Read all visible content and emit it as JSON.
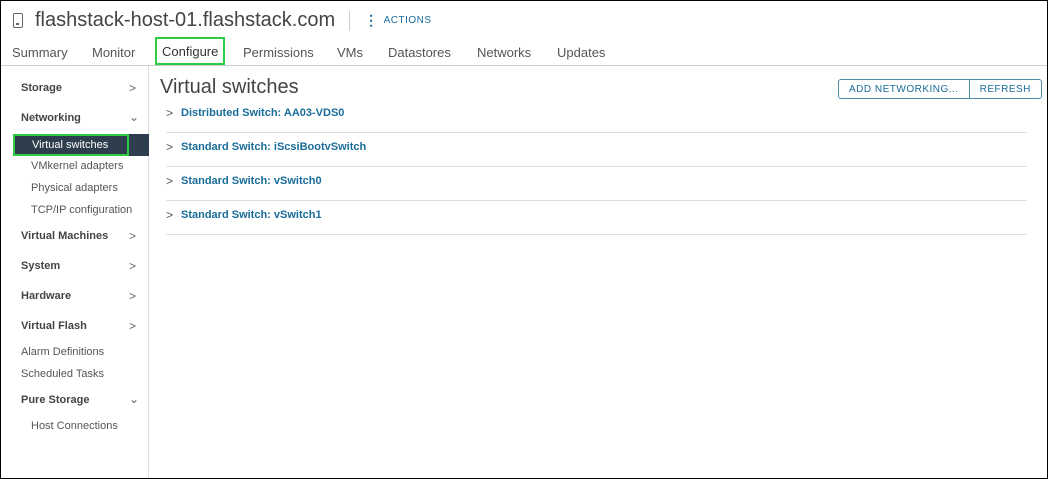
{
  "header": {
    "title": "flashstack-host-01.flashstack.com",
    "actions_label": "ACTIONS"
  },
  "tabs": [
    "Summary",
    "Monitor",
    "Configure",
    "Permissions",
    "VMs",
    "Datastores",
    "Networks",
    "Updates"
  ],
  "sidebar": {
    "storage": "Storage",
    "networking": "Networking",
    "virtual_switches": "Virtual switches",
    "vmkernel": "VMkernel adapters",
    "physical": "Physical adapters",
    "tcpip": "TCP/IP configuration",
    "virtual_machines": "Virtual Machines",
    "system": "System",
    "hardware": "Hardware",
    "virtual_flash": "Virtual Flash",
    "alarm": "Alarm Definitions",
    "scheduled": "Scheduled Tasks",
    "pure": "Pure Storage",
    "host_connections": "Host Connections"
  },
  "content": {
    "title": "Virtual switches",
    "add_networking": "ADD NETWORKING...",
    "refresh": "REFRESH",
    "switches": [
      "Distributed Switch: AA03-VDS0",
      "Standard Switch: iScsiBootvSwitch",
      "Standard Switch: vSwitch0",
      "Standard Switch: vSwitch1"
    ]
  }
}
